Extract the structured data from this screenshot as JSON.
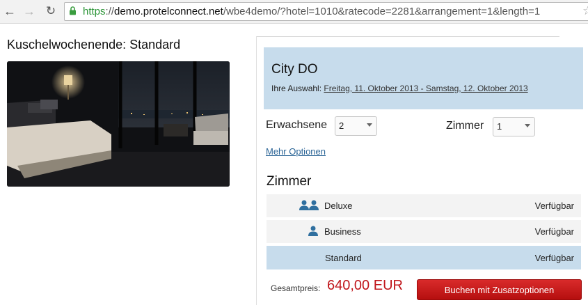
{
  "browser": {
    "url_scheme": "https",
    "url_sep": "://",
    "url_host": "demo.protelconnect.net",
    "url_path": "/wbe4demo/?hotel=1010&ratecode=2281&arrangement=1&length=1",
    "back_icon": "arrow-left-icon",
    "forward_icon": "arrow-right-icon",
    "reload_icon": "reload-icon",
    "lock_icon": "lock-icon",
    "bookmark_icon": "star-icon"
  },
  "offer": {
    "title": "Kuschelwochenende: Standard"
  },
  "hotel": {
    "name": "City DO",
    "selection_label": "Ihre Auswahl:",
    "selection_dates": "Freitag, 11. Oktober 2013 - Samstag, 12. Oktober 2013"
  },
  "occupancy": {
    "adults_label": "Erwachsene",
    "adults_value": "2",
    "rooms_label": "Zimmer",
    "rooms_value": "1"
  },
  "more_options": "Mehr Optionen",
  "rooms": {
    "heading": "Zimmer",
    "items": [
      {
        "name": "Deluxe",
        "status": "Verfügbar",
        "icon": "two-persons-icon"
      },
      {
        "name": "Business",
        "status": "Verfügbar",
        "icon": "person-icon"
      },
      {
        "name": "Standard",
        "status": "Verfügbar",
        "icon": ""
      }
    ]
  },
  "summary": {
    "total_label": "Gesamtpreis:",
    "total_price": "640,00 EUR",
    "book_button": "Buchen mit Zusatzoptionen"
  },
  "colors": {
    "accent_blue": "#c7dcec",
    "price_red": "#c0161b",
    "button_red": "#c81c1c",
    "https_green": "#2a9436"
  }
}
